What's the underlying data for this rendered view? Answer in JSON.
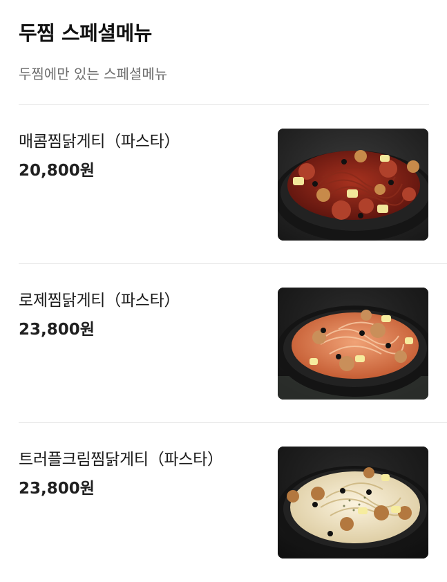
{
  "section": {
    "title": "두찜 스페셜메뉴",
    "subtitle": "두찜에만 있는 스페셜메뉴"
  },
  "menu_items": [
    {
      "name": "매콤찜닭게티（파스타）",
      "price": "20,800원",
      "photo_icon": "spicy-pasta-dish-photo",
      "sauce_color": "#7a1c14"
    },
    {
      "name": "로제찜닭게티（파스타）",
      "price": "23,800원",
      "photo_icon": "rose-pasta-dish-photo",
      "sauce_color": "#d9744a"
    },
    {
      "name": "트러플크림찜닭게티（파스타）",
      "price": "23,800원",
      "photo_icon": "truffle-cream-pasta-dish-photo",
      "sauce_color": "#ece3c9"
    }
  ]
}
